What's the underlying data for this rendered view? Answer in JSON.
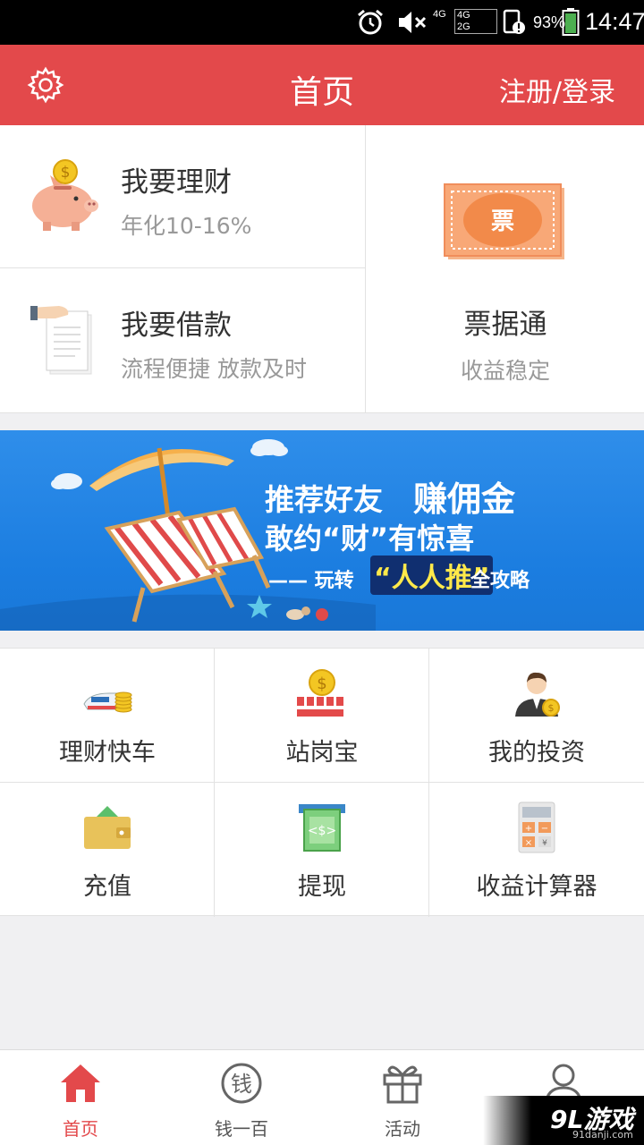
{
  "status_bar": {
    "net_top": "4G",
    "net_box_top": "4G",
    "net_box_bottom": "2G",
    "battery_pct": "93%",
    "time": "14:47"
  },
  "header": {
    "title": "首页",
    "login": "注册/登录"
  },
  "cards": {
    "finance": {
      "title": "我要理财",
      "sub": "年化10-16%",
      "coin_glyph": "$"
    },
    "loan": {
      "title": "我要借款",
      "sub": "流程便捷 放款及时"
    },
    "bill": {
      "title": "票据通",
      "sub": "收益稳定",
      "icon_text": "票"
    }
  },
  "banner": {
    "line1a": "推荐好友",
    "line1b": "赚佣金",
    "line2": "敢约“财”有惊喜",
    "line3a": "—— 玩转",
    "line3b": "“人人推”",
    "line3c": "全攻略"
  },
  "grid": [
    {
      "label": "理财快车",
      "icon": "train-coin-icon"
    },
    {
      "label": "站岗宝",
      "icon": "coin-fence-icon"
    },
    {
      "label": "我的投资",
      "icon": "investor-icon"
    },
    {
      "label": "充值",
      "icon": "wallet-icon"
    },
    {
      "label": "提现",
      "icon": "withdraw-icon"
    },
    {
      "label": "收益计算器",
      "icon": "calculator-icon"
    }
  ],
  "tabs": [
    {
      "label": "首页",
      "icon": "home-icon",
      "active": true
    },
    {
      "label": "钱一百",
      "icon": "money-icon",
      "glyph": "钱"
    },
    {
      "label": "活动",
      "icon": "gift-icon"
    },
    {
      "label": "",
      "icon": "user-icon"
    }
  ],
  "watermark": {
    "text": "9L游戏",
    "sub": "91danji.com"
  },
  "colors": {
    "brand_red": "#e3494b",
    "banner_blue": "#1b7de0"
  }
}
